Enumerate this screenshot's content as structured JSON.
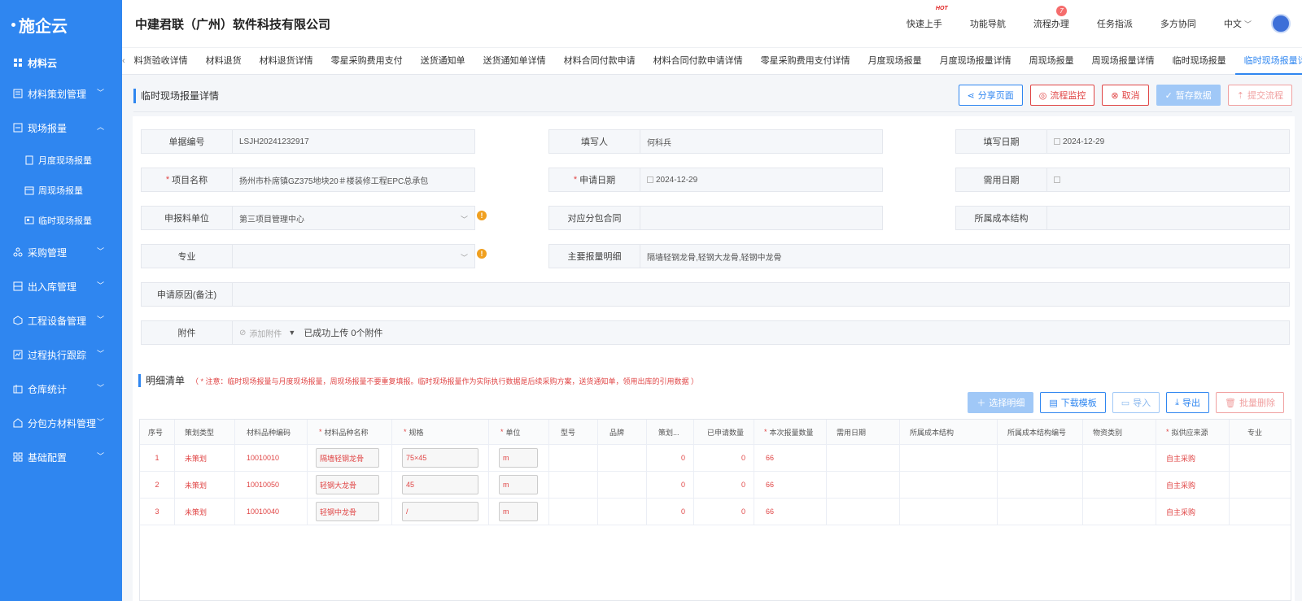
{
  "app": {
    "logo": "施企云",
    "company": "中建君联（广州）软件科技有限公司"
  },
  "sidebar": {
    "home": "材料云",
    "items": [
      {
        "label": "材料策划管理",
        "icon": "plan-icon"
      },
      {
        "label": "现场报量",
        "icon": "report-icon"
      },
      {
        "label": "采购管理",
        "icon": "purchase-icon"
      },
      {
        "label": "出入库管理",
        "icon": "warehouse-io-icon"
      },
      {
        "label": "工程设备管理",
        "icon": "equipment-icon"
      },
      {
        "label": "过程执行跟踪",
        "icon": "track-icon"
      },
      {
        "label": "仓库统计",
        "icon": "stats-icon"
      },
      {
        "label": "分包方材料管理",
        "icon": "subcontract-icon"
      },
      {
        "label": "基础配置",
        "icon": "config-icon"
      }
    ],
    "sub": [
      "月度现场报量",
      "周现场报量",
      "临时现场报量"
    ]
  },
  "header": {
    "quick": "快速上手",
    "hot": "HOT",
    "nav": "功能导航",
    "process": "流程办理",
    "process_badge": "7",
    "task": "任务指派",
    "collab": "多方协同",
    "lang": "中文"
  },
  "tabs": [
    "料货验收详情",
    "材料退货",
    "材料退货详情",
    "零星采购费用支付",
    "送货通知单",
    "送货通知单详情",
    "材料合同付款申请",
    "材料合同付款申请详情",
    "零星采购费用支付详情",
    "月度现场报量",
    "月度现场报量详情",
    "周现场报量",
    "周现场报量详情",
    "临时现场报量",
    "临时现场报量详情"
  ],
  "page": {
    "title": "临时现场报量详情",
    "buttons": {
      "share": "分享页面",
      "monitor": "流程监控",
      "cancel": "取消",
      "save": "暂存数据",
      "submit": "提交流程"
    }
  },
  "form": {
    "doc_no": {
      "label": "单据编号",
      "value": "LSJH20241232917"
    },
    "filler": {
      "label": "填写人",
      "value": "何科兵"
    },
    "fill_date": {
      "label": "填写日期",
      "value": "2024-12-29"
    },
    "project": {
      "label": "项目名称",
      "value": "扬州市朴席镇GZ375地块20＃楼装修工程EPC总承包"
    },
    "apply_date": {
      "label": "申请日期",
      "value": "2024-12-29"
    },
    "need_date": {
      "label": "需用日期",
      "value": ""
    },
    "unit": {
      "label": "申报料单位",
      "value": "第三项目管理中心"
    },
    "sub_contract": {
      "label": "对应分包合同",
      "value": ""
    },
    "cost_struct": {
      "label": "所属成本结构",
      "value": ""
    },
    "major": {
      "label": "专业",
      "value": ""
    },
    "main_detail": {
      "label": "主要报量明细",
      "value": "隔墙轻钢龙骨,轻钢大龙骨,轻钢中龙骨"
    },
    "reason": {
      "label": "申请原因(备注)",
      "value": ""
    },
    "attach": {
      "label": "附件",
      "add": "添加附件",
      "status": "已成功上传 0个附件"
    }
  },
  "detail": {
    "title": "明细清单",
    "note": "（ * 注意：临时现场报量与月度现场报量，周现场报量不要重复填报。临时现场报量作为实际执行数据是后续采购方案，送货通知单，领用出库的引用数据 ）",
    "buttons": {
      "select": "选择明细",
      "download": "下载模板",
      "import": "导入",
      "export": "导出",
      "batch_delete": "批量删除"
    },
    "columns": [
      "序号",
      "策划类型",
      "材料品种编码",
      "材料品种名称",
      "规格",
      "单位",
      "型号",
      "品牌",
      "策划...",
      "已申请数量",
      "本次报量数量",
      "需用日期",
      "所属成本结构",
      "所属成本结构编号",
      "物资类别",
      "拟供应来源",
      "专业"
    ],
    "rows": [
      {
        "no": "1",
        "type": "未策划",
        "code": "10010010",
        "name": "隔墙轻钢龙骨",
        "spec": "75×45",
        "unit": "m",
        "planned": "0",
        "applied": "0",
        "qty": "66",
        "source": "自主采购"
      },
      {
        "no": "2",
        "type": "未策划",
        "code": "10010050",
        "name": "轻钢大龙骨",
        "spec": "45",
        "unit": "m",
        "planned": "0",
        "applied": "0",
        "qty": "66",
        "source": "自主采购"
      },
      {
        "no": "3",
        "type": "未策划",
        "code": "10010040",
        "name": "轻钢中龙骨",
        "spec": "/",
        "unit": "m",
        "planned": "0",
        "applied": "0",
        "qty": "66",
        "source": "自主采购"
      }
    ]
  },
  "colors": {
    "primary": "#2f86f0",
    "danger": "#e04545",
    "sidebar": "#2f86f0"
  }
}
